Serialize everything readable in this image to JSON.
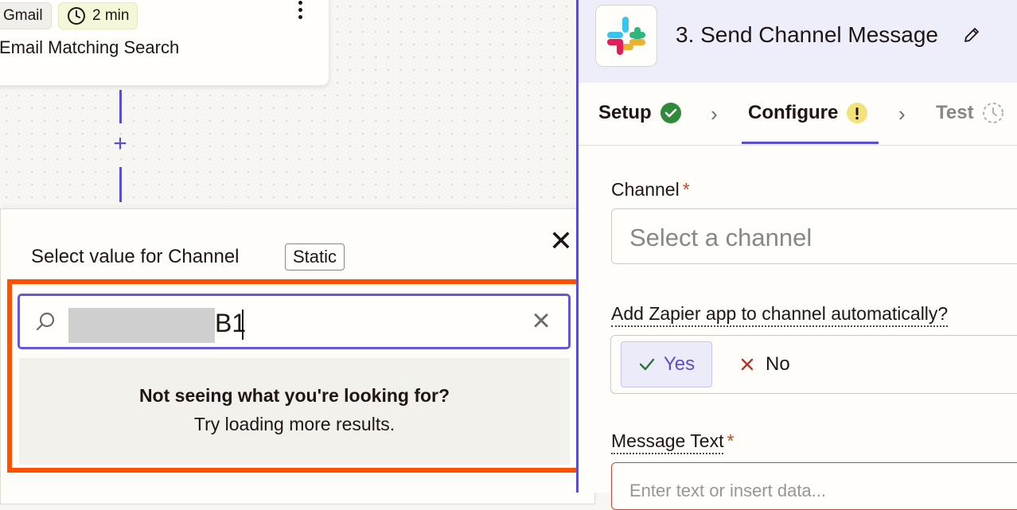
{
  "canvas": {
    "step_card": {
      "app_chip": "Gmail",
      "time_chip": "2 min",
      "title": "Email Matching Search"
    }
  },
  "popover": {
    "title": "Select value for Channel",
    "badge": "Static",
    "search": {
      "value_visible": "B1"
    },
    "empty_state": {
      "heading": "Not seeing what you're looking for?",
      "subtext": "Try loading more results."
    }
  },
  "panel": {
    "title": "3. Send Channel Message",
    "tabs": [
      {
        "label": "Setup",
        "status": "complete"
      },
      {
        "label": "Configure",
        "status": "warning"
      },
      {
        "label": "Test",
        "status": "pending"
      }
    ],
    "channel_field": {
      "label": "Channel",
      "required_mark": "*",
      "placeholder": "Select a channel"
    },
    "auto_add_field": {
      "label": "Add Zapier app to channel automatically?",
      "yes": "Yes",
      "no": "No",
      "selected": "Yes"
    },
    "message_field": {
      "label": "Message Text",
      "required_mark": "*",
      "placeholder": "Enter text or insert data..."
    }
  },
  "colors": {
    "accent": "#5b4fc9",
    "highlight": "#ff4f00",
    "success": "#2f8a3a",
    "warning": "#f2e27a",
    "required": "#d4421e"
  }
}
